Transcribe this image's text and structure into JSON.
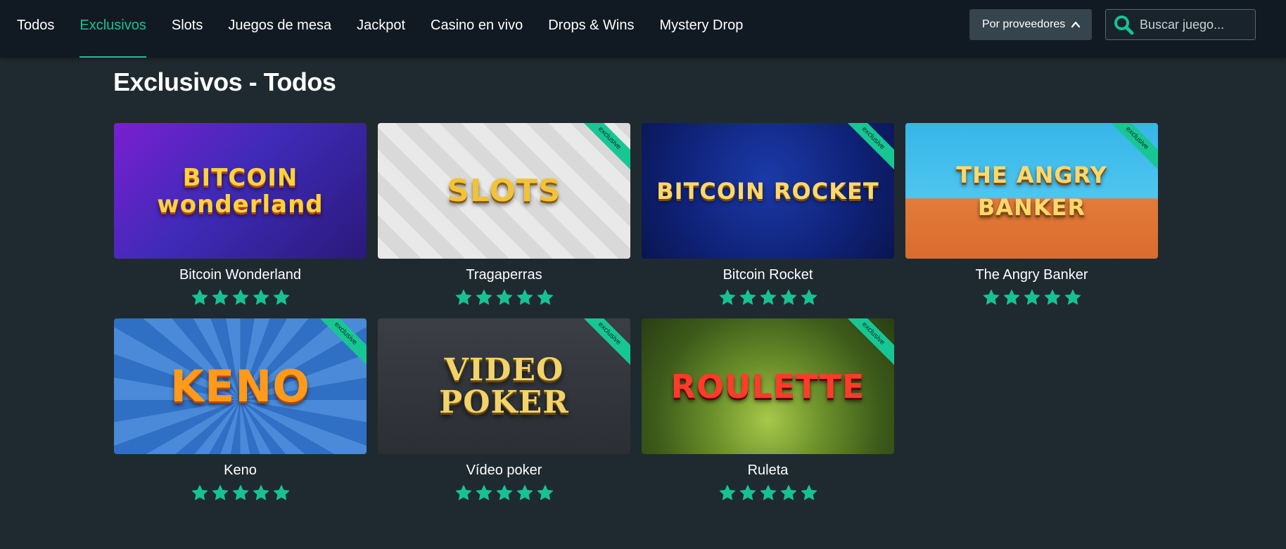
{
  "nav": {
    "tabs": [
      {
        "label": "Todos",
        "active": false
      },
      {
        "label": "Exclusivos",
        "active": true
      },
      {
        "label": "Slots",
        "active": false
      },
      {
        "label": "Juegos de mesa",
        "active": false
      },
      {
        "label": "Jackpot",
        "active": false
      },
      {
        "label": "Casino en vivo",
        "active": false
      },
      {
        "label": "Drops & Wins",
        "active": false
      },
      {
        "label": "Mystery Drop",
        "active": false
      }
    ],
    "provider_button": "Por proveedores",
    "search_placeholder": "Buscar juego..."
  },
  "page_title": "Exclusivos - Todos",
  "colors": {
    "accent": "#17c196",
    "background": "#1f2a30",
    "topbar": "#111a22"
  },
  "games": [
    {
      "name": "Bitcoin Wonderland",
      "art_text": "BITCOIN wonderland",
      "exclusive_ribbon": "",
      "stars": 5
    },
    {
      "name": "Tragaperras",
      "art_text": "SLOTS",
      "exclusive_ribbon": "exclusive",
      "stars": 5
    },
    {
      "name": "Bitcoin Rocket",
      "art_text": "BITCOIN ROCKET",
      "exclusive_ribbon": "exclusive",
      "stars": 5
    },
    {
      "name": "The Angry Banker",
      "art_text": "THE ANGRY BANKER",
      "exclusive_ribbon": "exclusive",
      "stars": 5
    },
    {
      "name": "Keno",
      "art_text": "KENO",
      "exclusive_ribbon": "exclusive",
      "stars": 5
    },
    {
      "name": "Vídeo poker",
      "art_text": "VIDEO POKER",
      "exclusive_ribbon": "exclusive",
      "stars": 5
    },
    {
      "name": "Ruleta",
      "art_text": "ROULETTE",
      "exclusive_ribbon": "exclusive",
      "stars": 5
    }
  ]
}
